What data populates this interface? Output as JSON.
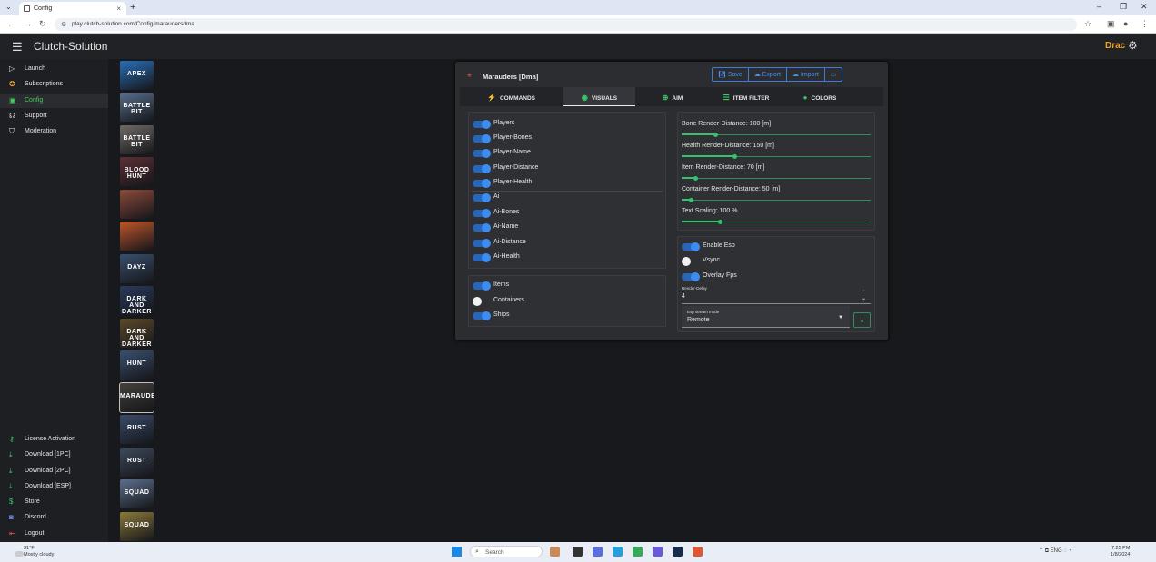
{
  "browser": {
    "tab_title": "Config",
    "url": "play.clutch-solution.com/Config/maraudersdma",
    "new_tab": "+",
    "close_tab": "×",
    "window_controls": [
      "–",
      "❐",
      "✕"
    ]
  },
  "app": {
    "title": "Clutch-Solution",
    "username": "Drac"
  },
  "sidebar": {
    "top_items": [
      {
        "label": "Launch",
        "icon": "play-icon"
      },
      {
        "label": "Subscriptions",
        "icon": "award-icon"
      },
      {
        "label": "Config",
        "icon": "config-icon",
        "active": true
      },
      {
        "label": "Support",
        "icon": "support-icon"
      },
      {
        "label": "Moderation",
        "icon": "shield-icon"
      }
    ],
    "bottom_items": [
      {
        "label": "License Activation",
        "icon": "key-icon"
      },
      {
        "label": "Download [1PC]",
        "icon": "download-icon"
      },
      {
        "label": "Download [2PC]",
        "icon": "download-icon"
      },
      {
        "label": "Download [ESP]",
        "icon": "download-icon"
      },
      {
        "label": "Store",
        "icon": "dollar-icon"
      },
      {
        "label": "Discord",
        "icon": "discord-icon"
      },
      {
        "label": "Logout",
        "icon": "logout-icon"
      }
    ]
  },
  "games": [
    {
      "label": "APEX",
      "color": "#2a6fb8"
    },
    {
      "label": "BATTLE BIT",
      "color": "#5a6f8c"
    },
    {
      "label": "BATTLE BIT",
      "color": "#6f6a66"
    },
    {
      "label": "BLOOD HUNT",
      "color": "#5c2f35"
    },
    {
      "label": "",
      "color": "#8c4a3a"
    },
    {
      "label": "",
      "color": "#c0562a"
    },
    {
      "label": "DAYZ",
      "color": "#3a4f6f"
    },
    {
      "label": "DARK AND DARKER",
      "color": "#2a3a5c"
    },
    {
      "label": "DARK AND DARKER",
      "color": "#5c4a2a"
    },
    {
      "label": "HUNT",
      "color": "#3a5070"
    },
    {
      "label": "MARAUDERS",
      "color": "#44403c",
      "selected": true
    },
    {
      "label": "RUST",
      "color": "#3a4a6a"
    },
    {
      "label": "RUST",
      "color": "#3f4a5c"
    },
    {
      "label": "SQUAD",
      "color": "#5c6f8c"
    },
    {
      "label": "SQUAD",
      "color": "#8c7a3a"
    }
  ],
  "config": {
    "title": "Marauders [Dma]",
    "buttons": [
      "Save",
      "Export",
      "Import",
      ""
    ],
    "tabs": [
      {
        "label": "COMMANDS",
        "icon": "⚡"
      },
      {
        "label": "VISUALS",
        "icon": "◉",
        "active": true
      },
      {
        "label": "AIM",
        "icon": "⊕"
      },
      {
        "label": "ITEM FILTER",
        "icon": "☰"
      },
      {
        "label": "COLORS",
        "icon": "●"
      }
    ],
    "player_toggles": [
      {
        "label": "Players",
        "on": true
      },
      {
        "label": "Player-Bones",
        "on": true
      },
      {
        "label": "Player-Name",
        "on": true
      },
      {
        "label": "Player-Distance",
        "on": true
      },
      {
        "label": "Player-Health",
        "on": true
      }
    ],
    "ai_toggles": [
      {
        "label": "Ai",
        "on": true
      },
      {
        "label": "Ai-Bones",
        "on": true
      },
      {
        "label": "Ai-Name",
        "on": true
      },
      {
        "label": "Ai-Distance",
        "on": true
      },
      {
        "label": "Ai-Health",
        "on": true
      }
    ],
    "item_toggles": [
      {
        "label": "Items",
        "on": true
      },
      {
        "label": "Containers",
        "on": false
      },
      {
        "label": "Ships",
        "on": true
      }
    ],
    "sliders": [
      {
        "label": "Bone Render-Distance: 100 [m]",
        "fraction": 0.18
      },
      {
        "label": "Health Render-Distance: 150 [m]",
        "fraction": 0.28
      },
      {
        "label": "Item Render-Distance: 70 [m]",
        "fraction": 0.07
      },
      {
        "label": "Container Render-Distance: 50 [m]",
        "fraction": 0.05
      },
      {
        "label": "Text Scaling: 100 %",
        "fraction": 0.2
      }
    ],
    "esp_toggles": [
      {
        "label": "Enable Esp",
        "on": true
      },
      {
        "label": "Vsync",
        "on": false
      },
      {
        "label": "Overlay Fps",
        "on": true
      }
    ],
    "render_delay": {
      "label": "Render-Delay",
      "value": "4"
    },
    "stream_mode": {
      "label": "Esp stream mode",
      "value": "Remote"
    }
  },
  "taskbar": {
    "weather_temp": "31°F",
    "weather_desc": "Mostly cloudy",
    "search_placeholder": "Search",
    "lang": "ENG",
    "time": "7:25 PM",
    "date": "1/8/2024"
  },
  "colors": {
    "accent_green": "#3ac964",
    "toggle_blue": "#3d8cf2",
    "button_blue": "#4a8ef0",
    "username_orange": "#e9a32a"
  }
}
